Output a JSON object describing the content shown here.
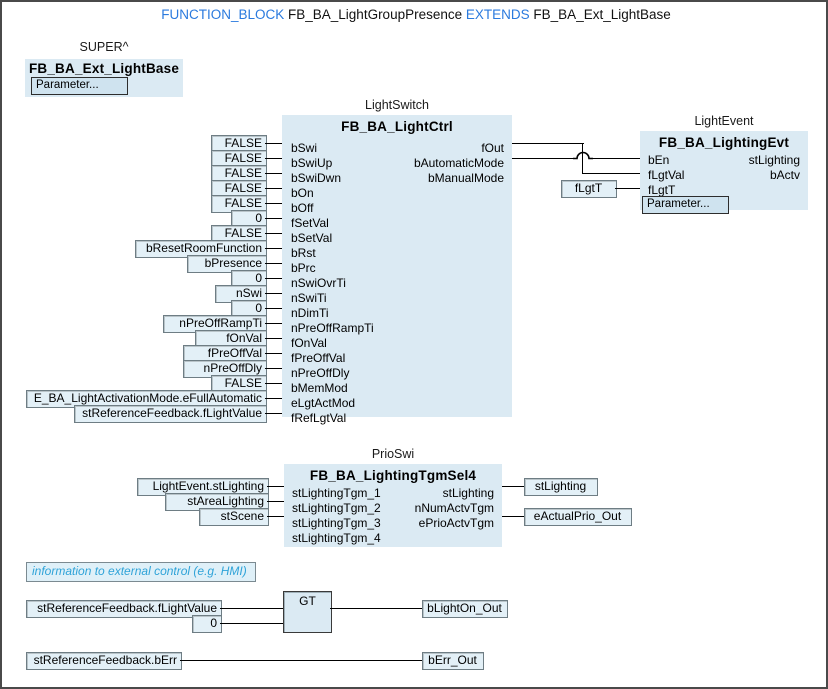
{
  "header": {
    "kw1": "FUNCTION_BLOCK",
    "name1": "FB_BA_LightGroupPresence",
    "kw2": "EXTENDS",
    "name2": "FB_BA_Ext_LightBase"
  },
  "colors": {
    "keyword_blue": "#2a7ade",
    "block_fill": "#dbeaf3",
    "box_fill": "#e3f0f7",
    "comment_cyan": "#2fa3d8",
    "wire": "#000000",
    "border": "#6e7d84"
  },
  "super_block": {
    "caption": "SUPER^",
    "title": "FB_BA_Ext_LightBase",
    "parameter_button": "Parameter..."
  },
  "light_switch": {
    "caption": "LightSwitch",
    "title": "FB_BA_LightCtrl",
    "inputs": [
      {
        "pin": "bSwi",
        "value": "FALSE"
      },
      {
        "pin": "bSwiUp",
        "value": "FALSE"
      },
      {
        "pin": "bSwiDwn",
        "value": "FALSE"
      },
      {
        "pin": "bOn",
        "value": "FALSE"
      },
      {
        "pin": "bOff",
        "value": "FALSE"
      },
      {
        "pin": "fSetVal",
        "value": "0"
      },
      {
        "pin": "bSetVal",
        "value": "FALSE"
      },
      {
        "pin": "bRst",
        "value": "bResetRoomFunction"
      },
      {
        "pin": "bPrc",
        "value": "bPresence"
      },
      {
        "pin": "nSwiOvrTi",
        "value": "0"
      },
      {
        "pin": "nSwiTi",
        "value": "nSwi"
      },
      {
        "pin": "nDimTi",
        "value": "0"
      },
      {
        "pin": "nPreOffRampTi",
        "value": "nPreOffRampTi"
      },
      {
        "pin": "fOnVal",
        "value": "fOnVal"
      },
      {
        "pin": "fPreOffVal",
        "value": "fPreOffVal"
      },
      {
        "pin": "nPreOffDly",
        "value": "nPreOffDly"
      },
      {
        "pin": "bMemMod",
        "value": "FALSE"
      },
      {
        "pin": "eLgtActMod",
        "value": "E_BA_LightActivationMode.eFullAutomatic"
      },
      {
        "pin": "fRefLgtVal",
        "value": "stReferenceFeedback.fLightValue"
      }
    ],
    "outputs": [
      {
        "pin": "fOut"
      },
      {
        "pin": "bAutomaticMode"
      },
      {
        "pin": "bManualMode"
      }
    ]
  },
  "light_event": {
    "caption": "LightEvent",
    "title": "FB_BA_LightingEvt",
    "inputs": [
      {
        "pin": "bEn",
        "value": ""
      },
      {
        "pin": "fLgtVal",
        "value": ""
      },
      {
        "pin": "fLgtT",
        "value": "fLgtT"
      }
    ],
    "outputs": [
      {
        "pin": "stLighting"
      },
      {
        "pin": "bActv"
      }
    ],
    "parameter_button": "Parameter..."
  },
  "prio_swi": {
    "caption": "PrioSwi",
    "title": "FB_BA_LightingTgmSel4",
    "inputs": [
      {
        "pin": "stLightingTgm_1",
        "value": "LightEvent.stLighting"
      },
      {
        "pin": "stLightingTgm_2",
        "value": "stAreaLighting"
      },
      {
        "pin": "stLightingTgm_3",
        "value": "stScene"
      },
      {
        "pin": "stLightingTgm_4",
        "value": ""
      }
    ],
    "outputs": [
      {
        "pin": "stLighting",
        "value": "stLighting"
      },
      {
        "pin": "nNumActvTgm",
        "value": ""
      },
      {
        "pin": "ePrioActvTgm",
        "value": "eActualPrio_Out"
      }
    ]
  },
  "hmi_section": {
    "comment": "information to external control (e.g. HMI)",
    "gt_operator": "GT",
    "gt_input_a": "stReferenceFeedback.fLightValue",
    "gt_input_b": "0",
    "gt_output": "bLightOn_Out",
    "err_input": "stReferenceFeedback.bErr",
    "err_output": "bErr_Out"
  }
}
